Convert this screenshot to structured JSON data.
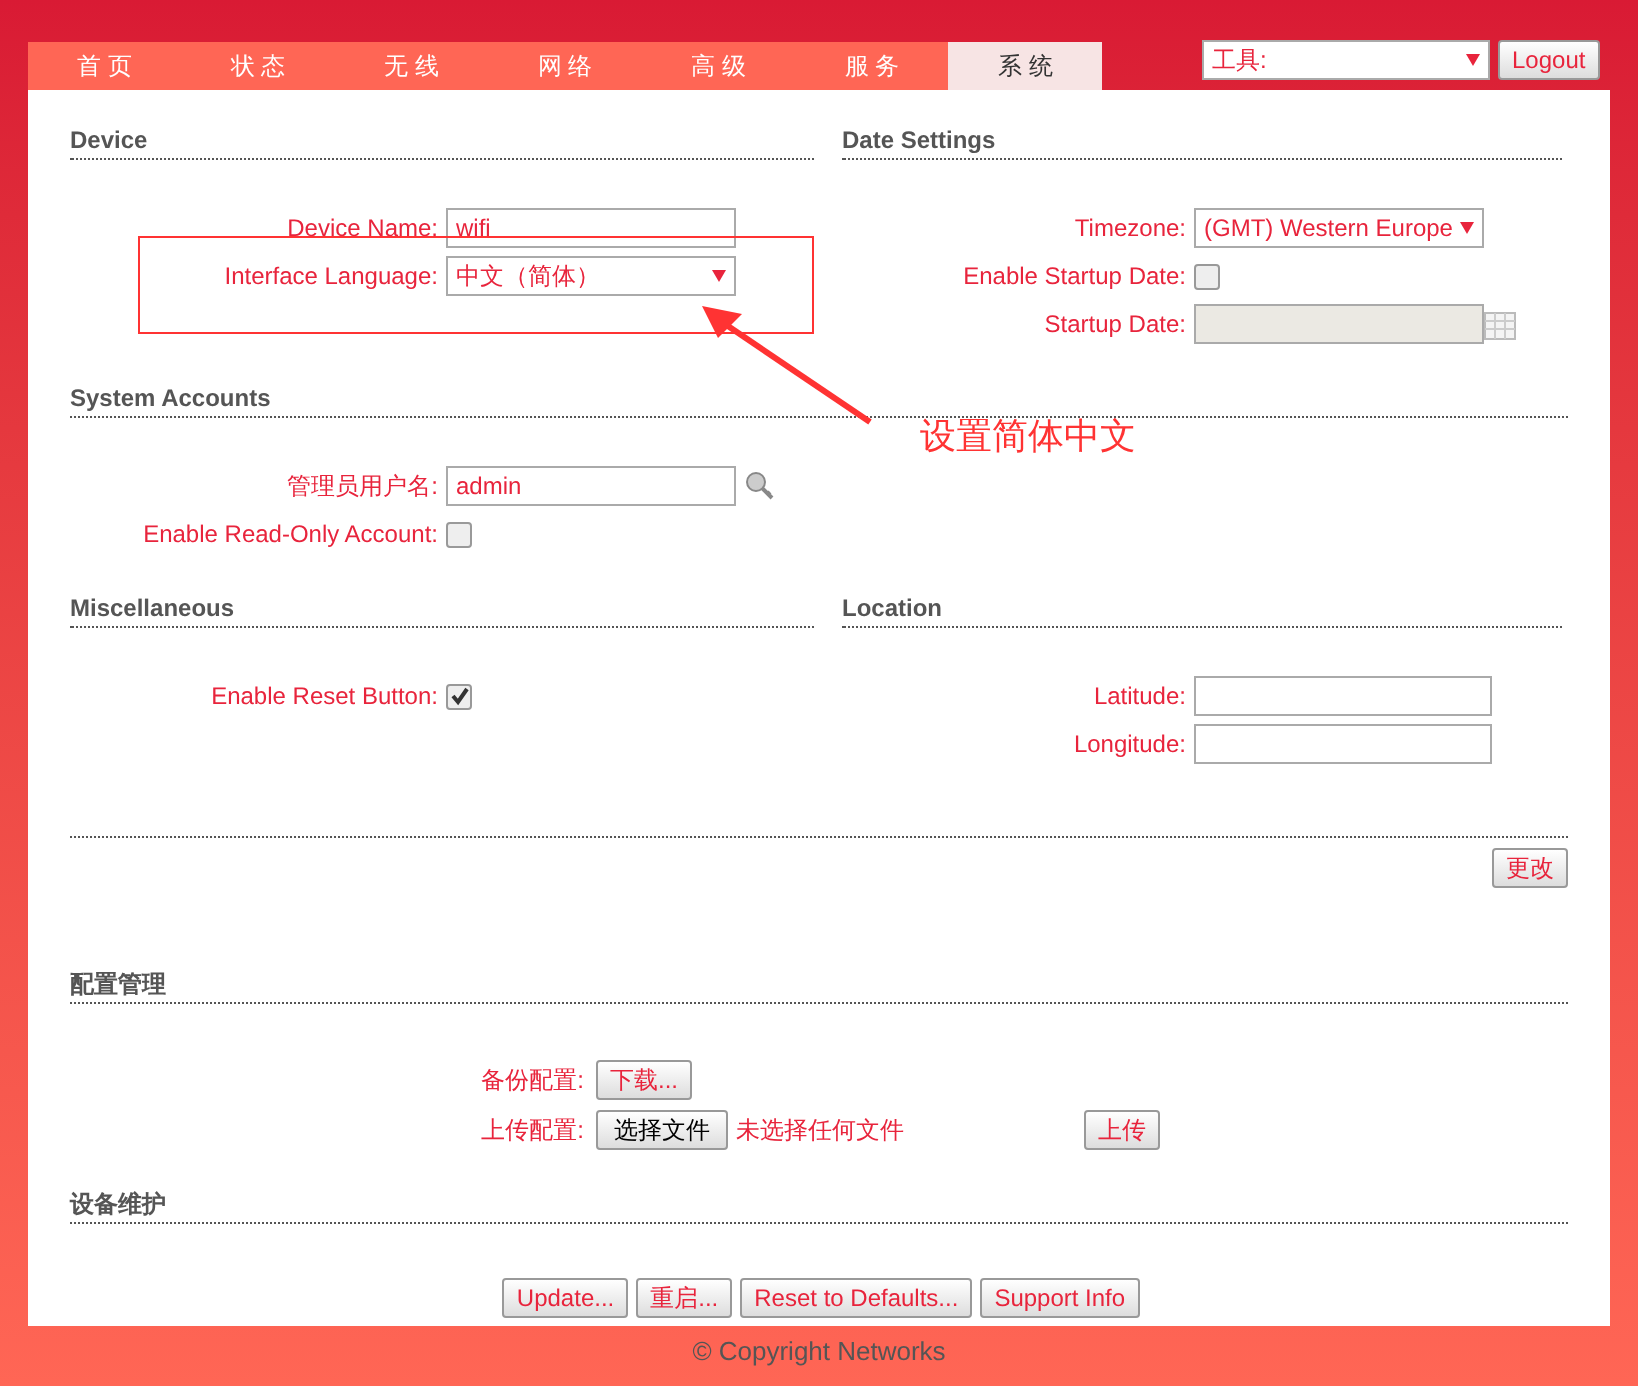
{
  "tabs": [
    {
      "label": "首 页",
      "selected": false
    },
    {
      "label": "状 态",
      "selected": false
    },
    {
      "label": "无 线",
      "selected": false
    },
    {
      "label": "网 络",
      "selected": false
    },
    {
      "label": "高 级",
      "selected": false
    },
    {
      "label": "服 务",
      "selected": false
    },
    {
      "label": "系 统",
      "selected": true
    }
  ],
  "tools_select": {
    "value": "工具:"
  },
  "logout_button": "Logout",
  "device": {
    "title": "Device",
    "fields": [
      {
        "kind": "text",
        "label": "Device Name:",
        "value": "wifi"
      },
      {
        "kind": "select",
        "label": "Interface Language:",
        "value": "中文（简体）"
      }
    ]
  },
  "date_settings": {
    "title": "Date Settings",
    "fields": [
      {
        "kind": "select",
        "label": "Timezone:",
        "value": "(GMT) Western Europe"
      },
      {
        "kind": "checkbox",
        "label": "Enable Startup Date:",
        "checked": false
      },
      {
        "kind": "date",
        "label": "Startup Date:",
        "disabled": true
      }
    ]
  },
  "system_accounts": {
    "title": "System Accounts",
    "fields": [
      {
        "kind": "user",
        "label": "管理员用户名:",
        "value": "admin"
      },
      {
        "kind": "checkbox",
        "label": "Enable Read-Only Account:",
        "checked": false
      }
    ]
  },
  "miscellaneous": {
    "title": "Miscellaneous",
    "fields": [
      {
        "kind": "checkbox",
        "label": "Enable Reset Button:",
        "checked": true
      }
    ]
  },
  "location": {
    "title": "Location",
    "fields": [
      {
        "kind": "text",
        "label": "Latitude:"
      },
      {
        "kind": "text",
        "label": "Longitude:"
      }
    ]
  },
  "change_button": "更改",
  "config": {
    "title": "配置管理",
    "backup_label": "备份配置:",
    "download_button": "下载...",
    "upload_label": "上传配置:",
    "choose_file_button": "选择文件",
    "no_file_text": "未选择任何文件",
    "upload_button": "上传"
  },
  "maintenance": {
    "title": "设备维护",
    "buttons": [
      "Update...",
      "重启...",
      "Reset to Defaults...",
      "Support Info"
    ]
  },
  "annotation": {
    "text": "设置简体中文"
  },
  "footer": "© Copyright Networks"
}
